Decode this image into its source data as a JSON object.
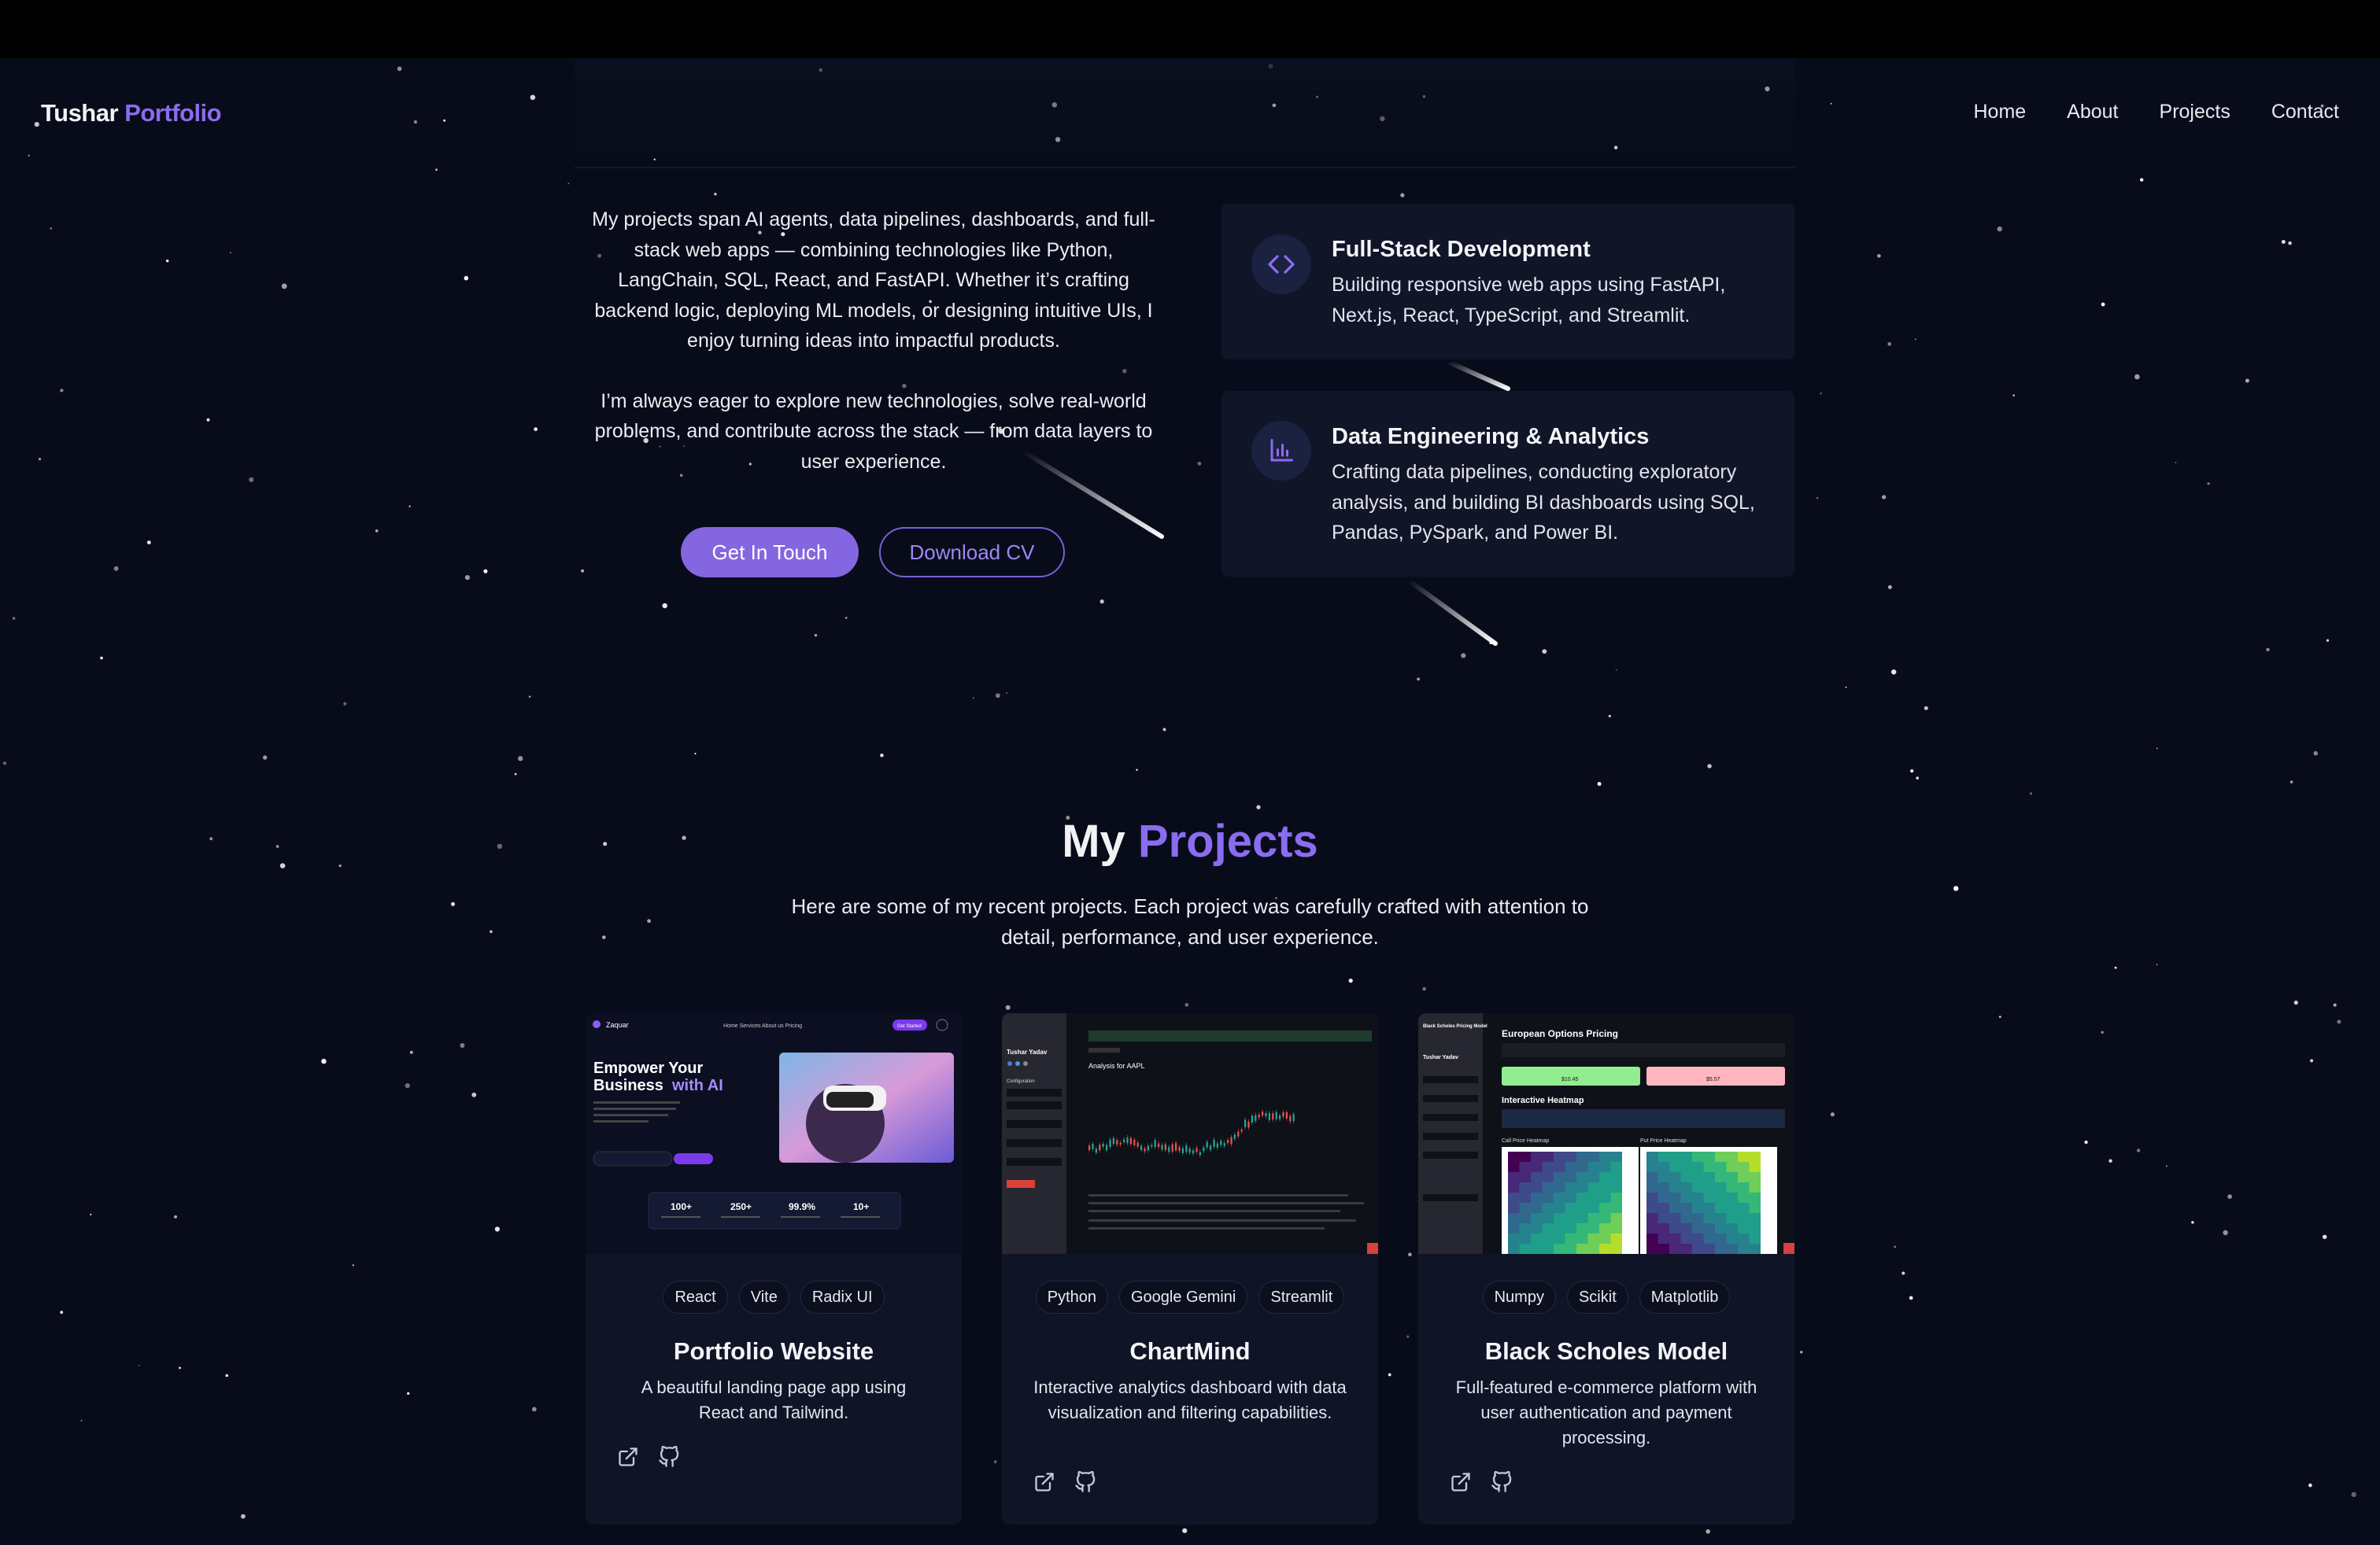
{
  "brand": {
    "first": "Tushar",
    "second": "Portfolio"
  },
  "nav": {
    "items": [
      "Home",
      "About",
      "Projects",
      "Contact"
    ]
  },
  "about": {
    "paragraph1": "My projects span AI agents, data pipelines, dashboards, and full-stack web apps — combining technologies like Python, LangChain, SQL, React, and FastAPI. Whether it’s crafting backend logic, deploying ML models, or designing intuitive UIs, I enjoy turning ideas into impactful products.",
    "paragraph2": "I’m always eager to explore new technologies, solve real-world problems, and contribute across the stack — from data layers to user experience.",
    "primary_button": "Get In Touch",
    "secondary_button": "Download CV"
  },
  "skills": [
    {
      "icon": "code-icon",
      "title": "Full-Stack Development",
      "description": "Building responsive web apps using FastAPI, Next.js, React, TypeScript, and Streamlit."
    },
    {
      "icon": "bar-chart-icon",
      "title": "Data Engineering & Analytics",
      "description": "Crafting data pipelines, conducting exploratory analysis, and building BI dashboards using SQL, Pandas, PySpark, and Power BI."
    }
  ],
  "projects_section": {
    "title_first": "My",
    "title_second": "Projects",
    "subtitle": "Here are some of my recent projects. Each project was carefully crafted with attention to detail, performance, and user experience."
  },
  "projects": [
    {
      "title": "Portfolio Website",
      "description": "A beautiful landing page app using React and Tailwind.",
      "tags": [
        "React",
        "Vite",
        "Radix UI"
      ],
      "thumb": {
        "logo": "Zaquar",
        "nav": "Home Services About us Pricing",
        "cta": "Get Started",
        "headline1": "Empower Your",
        "headline2": "Business",
        "headline3": "with AI",
        "stats": [
          {
            "value": "100+"
          },
          {
            "value": "250+"
          },
          {
            "value": "99.9%"
          },
          {
            "value": "10+"
          }
        ]
      }
    },
    {
      "title": "ChartMind",
      "description": "Interactive analytics dashboard with data visualization and filtering capabilities.",
      "tags": [
        "Python",
        "Google Gemini",
        "Streamlit"
      ],
      "thumb": {
        "sidebar_title": "Tushar Yadav",
        "chart_title": "Analysis for AAPL",
        "section": "Configuration"
      }
    },
    {
      "title": "Black Scholes Model",
      "description": "Full-featured e-commerce platform with user authentication and payment processing.",
      "tags": [
        "Numpy",
        "Scikit",
        "Matplotlib"
      ],
      "thumb": {
        "sidebar_title": "Black Scholes Pricing Model",
        "sidebar_name": "Tushar Yadav",
        "title": "European Options Pricing",
        "call_value": "$10.45",
        "put_value": "$5.57",
        "heatmap_title": "Interactive Heatmap",
        "call_heatmap": "Call Price Heatmap",
        "put_heatmap": "Put Price Heatmap"
      }
    }
  ],
  "colors": {
    "accent": "#8b6cf0",
    "background": "#080c1a",
    "card": "#0f1427"
  }
}
